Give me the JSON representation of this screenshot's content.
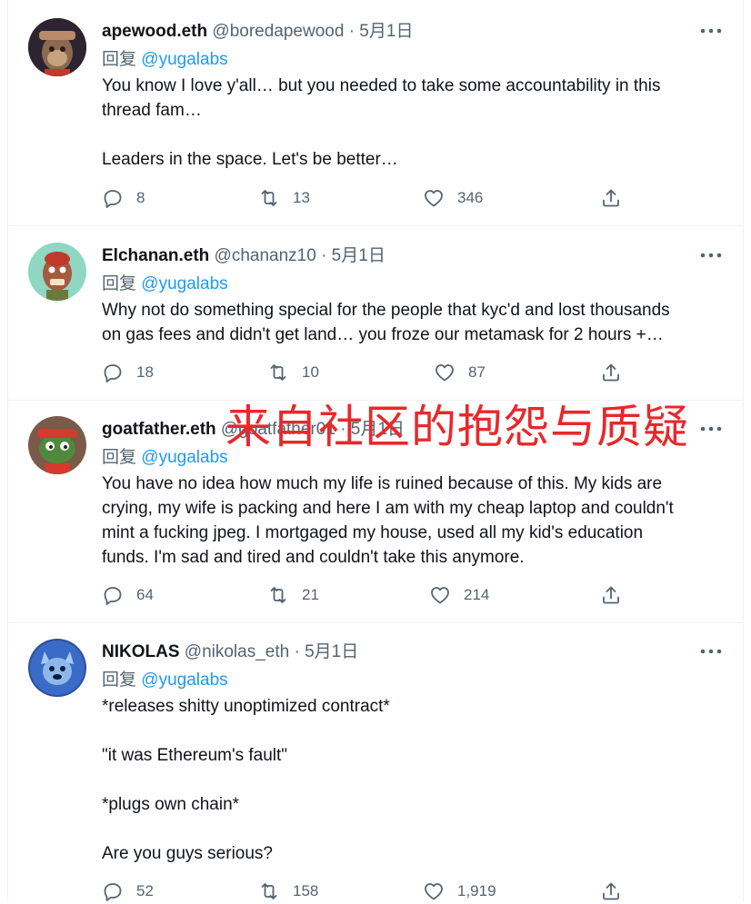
{
  "overlay_text": "来自社区的抱怨与质疑",
  "tweets": [
    {
      "name": "apewood.eth",
      "handle": "@boredapewood",
      "date": "· 5月1日",
      "reply_prefix": "回复",
      "reply_to": "@yugalabs",
      "text": "You know I love y'all… but you needed to take some accountability in this\nthread fam…\n\nLeaders in the space. Let's be better…",
      "replies": "8",
      "retweets": "13",
      "likes": "346"
    },
    {
      "name": "Elchanan.eth",
      "handle": "@chananz10",
      "date": "· 5月1日",
      "reply_prefix": "回复",
      "reply_to": "@yugalabs",
      "text": "Why not do something special for the people that kyc'd and lost thousands\non gas fees and didn't get land… you froze our metamask for 2 hours +…",
      "replies": "18",
      "retweets": "10",
      "likes": "87"
    },
    {
      "name": "goatfather.eth",
      "handle": "@goatfather01",
      "date": "· 5月1日",
      "reply_prefix": "回复",
      "reply_to": "@yugalabs",
      "text": "You have no idea how much my life is ruined because of this. My kids are\ncrying, my wife is packing and here I am with my cheap laptop and couldn't\nmint a fucking jpeg. I mortgaged my house, used all my kid's education\nfunds. I'm sad and tired and couldn't take this anymore.",
      "replies": "64",
      "retweets": "21",
      "likes": "214"
    },
    {
      "name": "NIKOLAS",
      "handle": "@nikolas_eth",
      "date": "· 5月1日",
      "reply_prefix": "回复",
      "reply_to": "@yugalabs",
      "text": "*releases shitty unoptimized contract*\n\n\"it was Ethereum's fault\"\n\n*plugs own chain*\n\nAre you guys serious?",
      "replies": "52",
      "retweets": "158",
      "likes": "1,919"
    }
  ],
  "icons": {
    "more": "more-horizontal-icon",
    "reply": "reply-icon",
    "retweet": "retweet-icon",
    "like": "heart-icon",
    "share": "share-icon"
  },
  "colors": {
    "text": "#0f1419",
    "muted": "#536471",
    "link": "#1d9bf0",
    "overlay": "#e8282b"
  }
}
